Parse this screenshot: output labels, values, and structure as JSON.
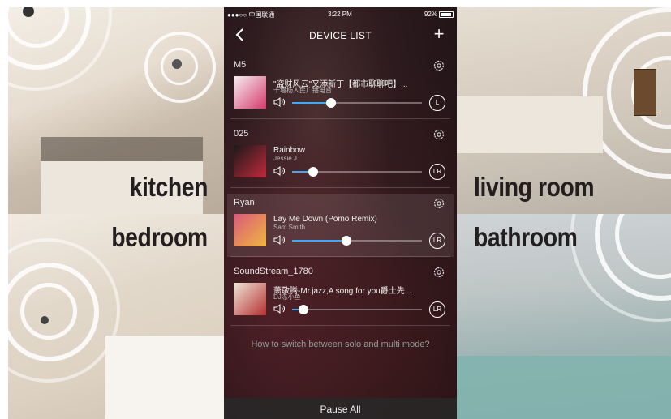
{
  "labels": {
    "kitchen": "kitchen",
    "bedroom": "bedroom",
    "living_room": "living room",
    "bathroom": "bathroom"
  },
  "status_bar": {
    "carrier": "●●●○○ 中国联通",
    "time": "3:22 PM",
    "battery": "92%"
  },
  "nav": {
    "title": "DEVICE LIST",
    "back_icon": "chevron-left-icon",
    "add_icon": "plus-icon",
    "add_symbol": "+"
  },
  "devices": [
    {
      "name": "M5",
      "song": "\"盗财风云\"又添新丁【都市聊聊吧】...",
      "artist": "十堰杨人民广播电台",
      "channel": "L",
      "volume": 0.3,
      "cover_colors": [
        "#f4f0f2",
        "#d63a6c"
      ]
    },
    {
      "name": "025",
      "song": "Rainbow",
      "artist": "Jessie J",
      "channel": "LR",
      "volume": 0.16,
      "cover_colors": [
        "#1a1a1a",
        "#c02a3a"
      ]
    },
    {
      "name": "Ryan",
      "song": "Lay Me Down (Pomo Remix)",
      "artist": "Sam Smith",
      "channel": "LR",
      "volume": 0.42,
      "cover_colors": [
        "#d95a7a",
        "#f0b640"
      ]
    },
    {
      "name": "SoundStream_1780",
      "song": "萧敬腾-Mr.jazz,A song for you爵士先...",
      "artist": "DJ冻小鱼",
      "channel": "LR",
      "volume": 0.09,
      "cover_colors": [
        "#efe6d8",
        "#b43030"
      ]
    }
  ],
  "help_link": "How to switch between solo and multi mode?",
  "bottom": {
    "pause_all": "Pause All"
  },
  "colors": {
    "accent": "#3fa9f5",
    "label_text": "#231f20"
  }
}
